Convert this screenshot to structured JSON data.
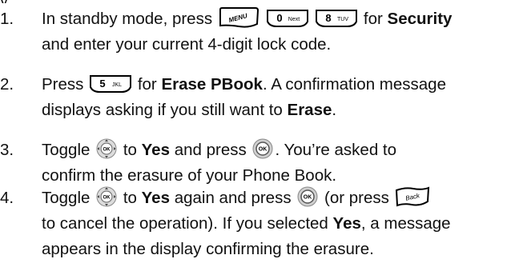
{
  "steps": [
    {
      "number": "1.",
      "l1_a": "In standby mode, press",
      "l1_b": "for",
      "l1_bold": "Security",
      "l2": "and enter your current 4-digit lock code."
    },
    {
      "number": "2.",
      "l1_a": "Press",
      "l1_b": "for",
      "l1_bold": "Erase PBook",
      "l1_c": ". A confirmation message",
      "l2_a": "displays asking if you still want to",
      "l2_bold": "Erase",
      "l2_c": "."
    },
    {
      "number": "3.",
      "l1_a": "Toggle",
      "l1_b": "to",
      "l1_bold": "Yes",
      "l1_c": "and press",
      "l1_d": ". You’re asked to",
      "l2": "confirm the erasure of your Phone Book."
    },
    {
      "number": "4.",
      "l1_a": "Toggle",
      "l1_b": "to",
      "l1_bold": "Yes",
      "l1_c": "again and press",
      "l1_d": "(or press",
      "l2_a": "to cancel the operation). If you selected",
      "l2_bold": "Yes",
      "l2_c": ", a message",
      "l3": "appears in the display confirming the erasure."
    }
  ],
  "keys": {
    "menu": "MENU",
    "zero_digit": "0",
    "zero_letters": "Next",
    "eight_digit": "8",
    "eight_letters": "TUV",
    "five_digit": "5",
    "five_letters": "JKL",
    "ok": "OK",
    "back": "Back"
  }
}
